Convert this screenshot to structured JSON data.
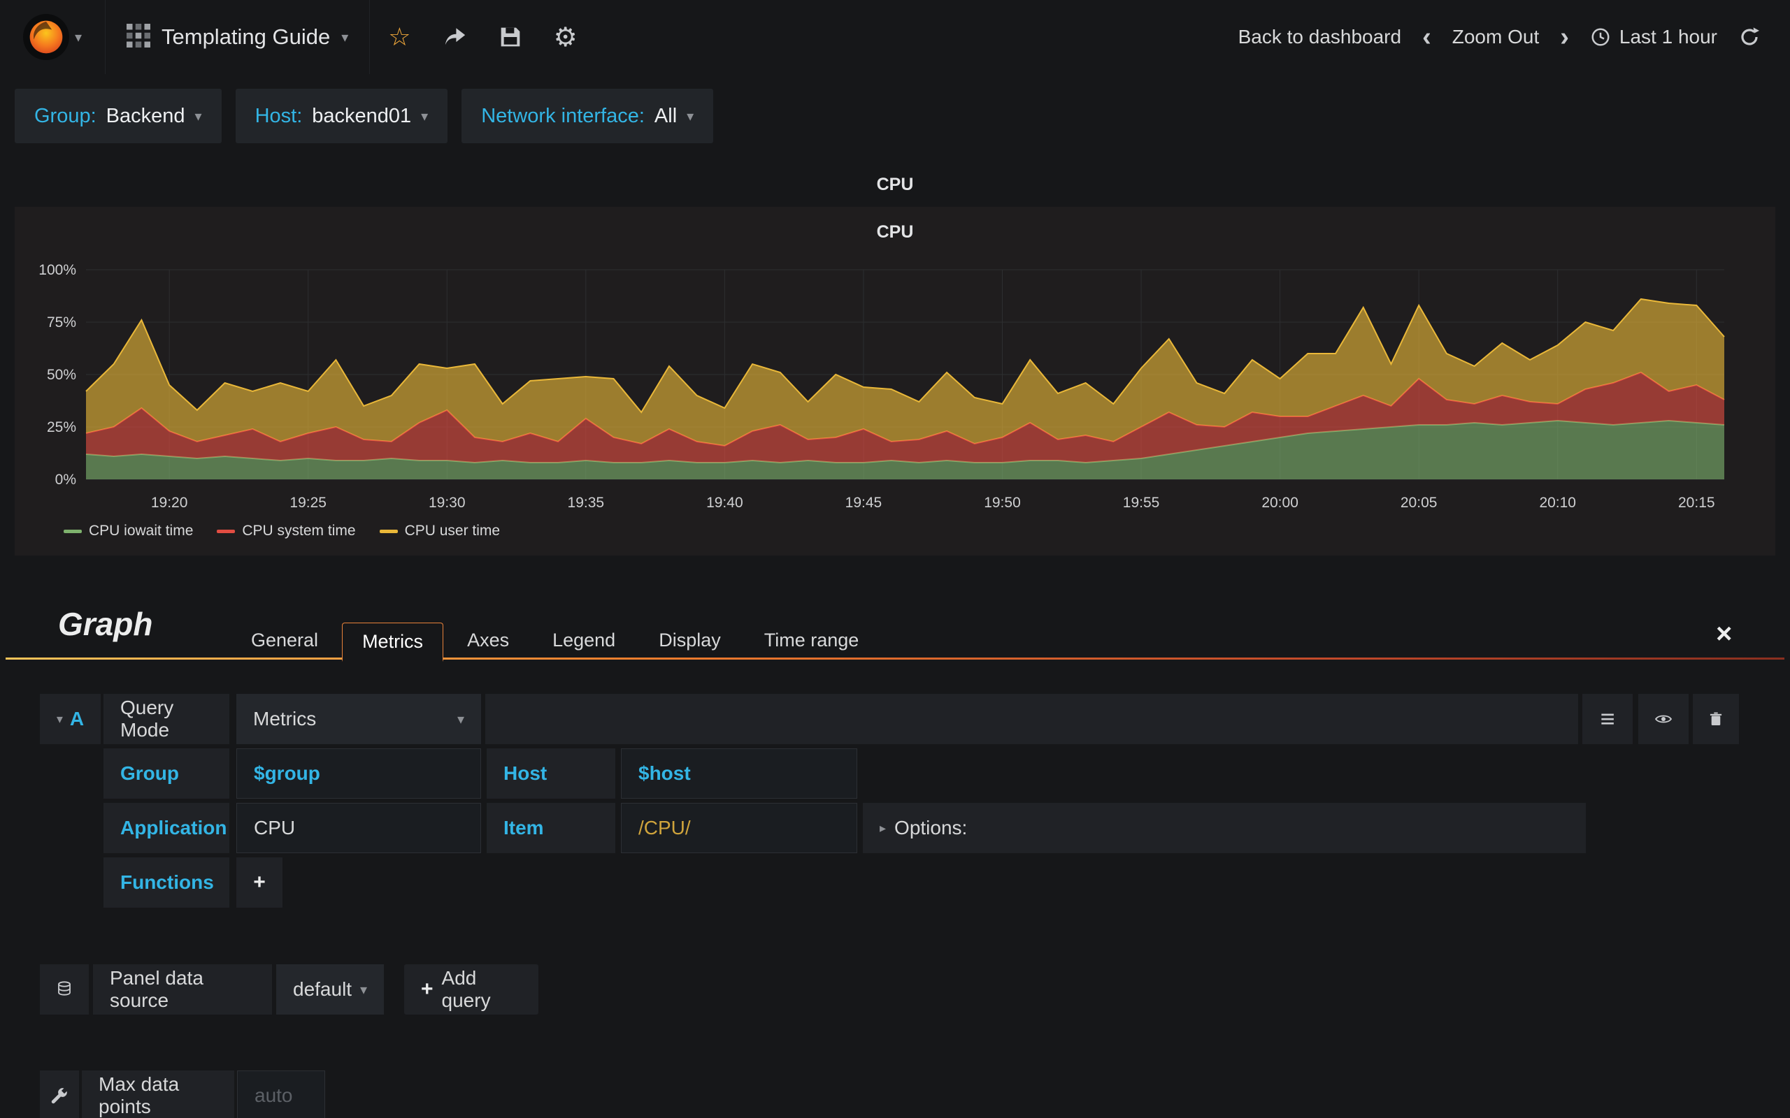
{
  "navbar": {
    "title": "Templating Guide",
    "back_to_dashboard": "Back to dashboard",
    "zoom_out": "Zoom Out",
    "time_range": "Last 1 hour"
  },
  "variables": [
    {
      "label": "Group:",
      "value": "Backend"
    },
    {
      "label": "Host:",
      "value": "backend01"
    },
    {
      "label": "Network interface:",
      "value": "All"
    }
  ],
  "panel": {
    "row_title": "CPU"
  },
  "chart_data": {
    "type": "area",
    "stacked": true,
    "title": "CPU",
    "xlabel": "",
    "ylabel": "",
    "ylim": [
      0,
      100
    ],
    "y_ticks": [
      "0%",
      "25%",
      "50%",
      "75%",
      "100%"
    ],
    "x_ticks": [
      "19:20",
      "19:25",
      "19:30",
      "19:35",
      "19:40",
      "19:45",
      "19:50",
      "19:55",
      "20:00",
      "20:05",
      "20:10",
      "20:15"
    ],
    "x_tick_indices": [
      3,
      8,
      13,
      18,
      23,
      28,
      33,
      38,
      43,
      48,
      53,
      58
    ],
    "grid": true,
    "legend_position": "bottom-left",
    "series": [
      {
        "name": "CPU iowait time",
        "color": "#7eb26d",
        "values": [
          12,
          11,
          12,
          11,
          10,
          11,
          10,
          9,
          10,
          9,
          9,
          10,
          9,
          9,
          8,
          9,
          8,
          8,
          9,
          8,
          8,
          9,
          8,
          8,
          9,
          8,
          9,
          8,
          8,
          9,
          8,
          9,
          8,
          8,
          9,
          9,
          8,
          9,
          10,
          12,
          14,
          16,
          18,
          20,
          22,
          23,
          24,
          25,
          26,
          26,
          27,
          26,
          27,
          28,
          27,
          26,
          27,
          28,
          27,
          26
        ]
      },
      {
        "name": "CPU system time",
        "color": "#e24d42",
        "values": [
          10,
          14,
          22,
          12,
          8,
          10,
          14,
          9,
          12,
          16,
          10,
          8,
          18,
          24,
          12,
          9,
          14,
          10,
          20,
          12,
          9,
          15,
          10,
          8,
          14,
          18,
          10,
          12,
          16,
          9,
          11,
          14,
          9,
          12,
          18,
          10,
          13,
          9,
          15,
          20,
          12,
          9,
          14,
          10,
          8,
          12,
          16,
          10,
          22,
          12,
          9,
          14,
          10,
          8,
          16,
          20,
          24,
          14,
          18,
          12
        ]
      },
      {
        "name": "CPU user time",
        "color": "#eab839",
        "values": [
          20,
          30,
          42,
          22,
          15,
          25,
          18,
          28,
          20,
          32,
          16,
          22,
          28,
          20,
          35,
          18,
          25,
          30,
          20,
          28,
          15,
          30,
          22,
          18,
          32,
          25,
          18,
          30,
          20,
          25,
          18,
          28,
          22,
          16,
          30,
          22,
          25,
          18,
          28,
          35,
          20,
          16,
          25,
          18,
          30,
          25,
          42,
          20,
          35,
          22,
          18,
          25,
          20,
          28,
          32,
          25,
          35,
          42,
          38,
          30
        ]
      }
    ]
  },
  "editor": {
    "panel_type_label": "Graph",
    "tabs": [
      "General",
      "Metrics",
      "Axes",
      "Legend",
      "Display",
      "Time range"
    ],
    "active_tab": "Metrics",
    "query": {
      "ref": "A",
      "mode_label": "Query Mode",
      "mode_value": "Metrics",
      "group_label": "Group",
      "group_value": "$group",
      "host_label": "Host",
      "host_value": "$host",
      "application_label": "Application",
      "application_value": "CPU",
      "item_label": "Item",
      "item_value": "/CPU/",
      "options_label": "Options:",
      "functions_label": "Functions"
    },
    "datasource": {
      "label": "Panel data source",
      "value": "default",
      "add_query_label": "Add query"
    },
    "options_row": {
      "max_data_points_label": "Max data points",
      "max_data_points_placeholder": "auto"
    }
  }
}
